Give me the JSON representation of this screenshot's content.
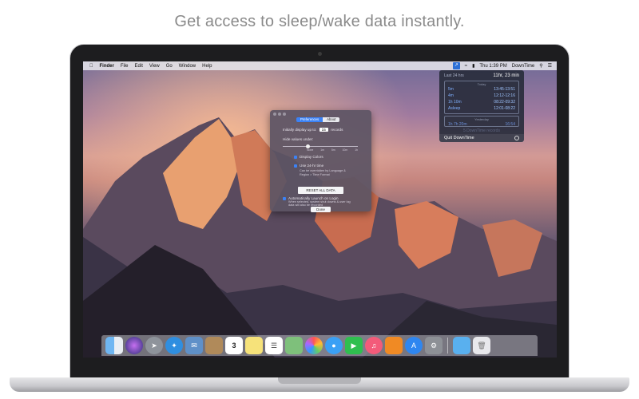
{
  "headline": "Get access to sleep/wake data instantly.",
  "menubar": {
    "items": [
      "Finder",
      "File",
      "Edit",
      "View",
      "Go",
      "Window",
      "Help"
    ],
    "clock": "Thu 1:39 PM",
    "app_name": "DownTime"
  },
  "dropdown": {
    "header_label": "Last 24 hrs",
    "header_total": "11hr, 23 min",
    "section_today": "Today",
    "rows_today": [
      {
        "value": "5m",
        "time": "13:45-13:51"
      },
      {
        "value": "4m",
        "time": "12:12-12:16"
      },
      {
        "value": "1h 10m",
        "time": "08:22-09:32"
      },
      {
        "value": "Asleep",
        "time": "12:01-08:22"
      }
    ],
    "section_yesterday": "Yesterday",
    "rows_yesterday": [
      {
        "value": "1h 7h 20m",
        "time": "16:54"
      }
    ],
    "more": "5 DownTime records",
    "quit": "Quit DownTime"
  },
  "prefs": {
    "tab_prefs": "Preferences",
    "tab_about": "About",
    "display_prefix": "Initially display up to:",
    "display_count": "15",
    "display_suffix": "records",
    "hide_label": "Hide values under:",
    "ticks": [
      "None",
      "1m",
      "5m",
      "10m",
      "1h"
    ],
    "opt_colors": "Display Colors",
    "opt_24hr": "Use 24-hr time",
    "opt_24hr_sub1": "Can be overridden by Language &",
    "opt_24hr_sub2": "Region > Time Format",
    "reset": "RESET ALL DATA",
    "opt_launch": "Automatically Launch on Login",
    "opt_launch_sub1": "When selected, system shut downs & user log",
    "opt_launch_sub2": "data will also be recorded",
    "done": "Done"
  },
  "dock": {
    "apps": [
      "finder-icon",
      "siri-icon",
      "launchpad-icon",
      "safari-icon",
      "mail-icon",
      "contacts-icon",
      "calendar-icon",
      "notes-icon",
      "reminders-icon",
      "maps-icon",
      "photos-icon",
      "messages-icon",
      "facetime-icon",
      "music-icon",
      "books-icon",
      "appstore-icon",
      "settings-icon"
    ],
    "calendar_day": "3",
    "trailing": [
      "folder-icon",
      "trash-icon"
    ]
  }
}
